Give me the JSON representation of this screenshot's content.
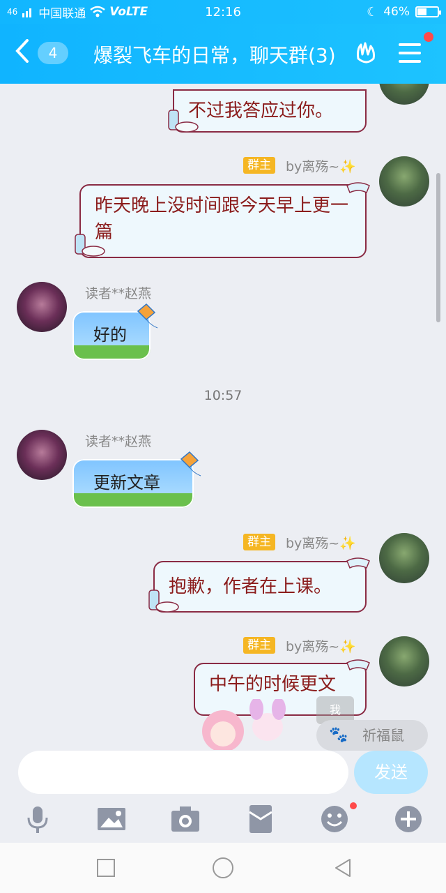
{
  "status": {
    "carrier": "中国联通",
    "network": "VoLTE",
    "time": "12:16",
    "battery": "46%",
    "signal_prefix": "46"
  },
  "header": {
    "unread_count": "4",
    "title": "爆裂飞车的日常，聊天群(3)"
  },
  "messages": [
    {
      "side": "right",
      "text": "不过我答应过你。"
    },
    {
      "side": "right",
      "tag": "群主",
      "sender": "by离殇~✨",
      "text": "昨天晚上没时间跟今天早上更一篇"
    },
    {
      "side": "left",
      "sender": "读者**赵燕",
      "text": "好的"
    },
    {
      "side": "left",
      "sender": "读者**赵燕",
      "text": "更新文章"
    },
    {
      "side": "right",
      "tag": "群主",
      "sender": "by离殇~✨",
      "text": "抱歉，作者在上课。"
    },
    {
      "side": "right",
      "tag": "群主",
      "sender": "by离殇~✨",
      "text": "中午的时候更文"
    }
  ],
  "time_divider": "10:57",
  "input": {
    "placeholder": "",
    "send_label": "发送"
  },
  "overlay": {
    "me_label": "我",
    "pet_label": "祈福鼠"
  },
  "colors": {
    "header": "#1cbcff",
    "owner_tag": "#f5b623",
    "bubble_border": "#8a2b44",
    "bubble_text": "#8b1c1c"
  }
}
